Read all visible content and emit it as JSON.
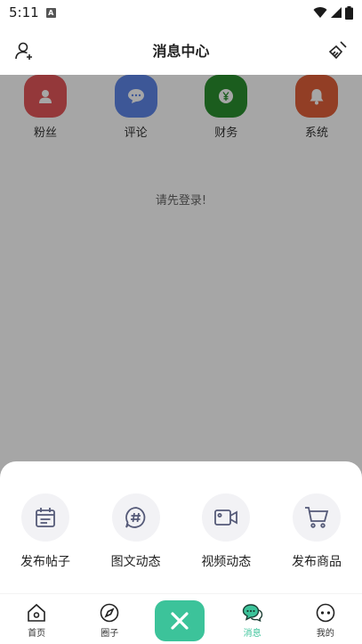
{
  "status": {
    "time": "5:11",
    "a_badge": "A"
  },
  "header": {
    "title": "消息中心"
  },
  "categories": [
    {
      "label": "粉丝",
      "color": "#e4575a",
      "icon": "person-icon"
    },
    {
      "label": "评论",
      "color": "#5f86e8",
      "icon": "comment-icon"
    },
    {
      "label": "财务",
      "color": "#2a8f2f",
      "icon": "yuan-icon"
    },
    {
      "label": "系统",
      "color": "#e0603a",
      "icon": "bell-icon"
    }
  ],
  "login_hint": "请先登录!",
  "actions": [
    {
      "label": "发布帖子",
      "icon": "calendar-post-icon"
    },
    {
      "label": "图文动态",
      "icon": "hashtag-icon"
    },
    {
      "label": "视频动态",
      "icon": "video-camera-icon"
    },
    {
      "label": "发布商品",
      "icon": "cart-icon"
    }
  ],
  "tabs": [
    {
      "label": "首页",
      "icon": "home-icon"
    },
    {
      "label": "圈子",
      "icon": "compass-icon"
    },
    {
      "label": "消息",
      "icon": "message-icon",
      "active": true
    },
    {
      "label": "我的",
      "icon": "profile-icon"
    }
  ],
  "colors": {
    "accent": "#3cc39a"
  }
}
